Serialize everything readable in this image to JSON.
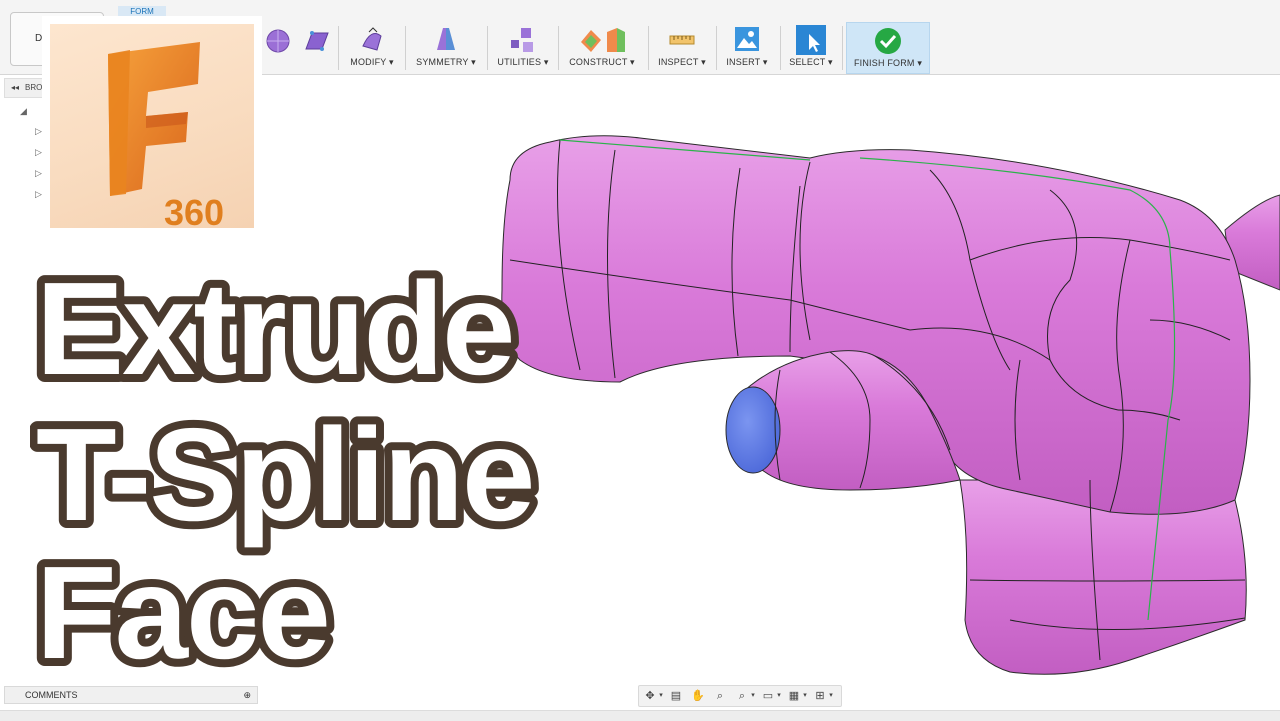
{
  "toolbar": {
    "form_tab": "FORM",
    "workspace_button": "D",
    "groups": [
      {
        "label": "MODIFY"
      },
      {
        "label": "SYMMETRY"
      },
      {
        "label": "UTILITIES"
      },
      {
        "label": "CONSTRUCT"
      },
      {
        "label": "INSPECT"
      },
      {
        "label": "INSERT"
      },
      {
        "label": "SELECT"
      },
      {
        "label": "FINISH FORM"
      }
    ]
  },
  "browser": {
    "label": "BRO"
  },
  "logo": {
    "text": "360"
  },
  "title": {
    "line1": "Extrude",
    "line2": "T-Spline",
    "line3": "Face"
  },
  "bottom": {
    "comments_label": "COMMENTS"
  },
  "colors": {
    "model_fill": "#d97ad9",
    "selected_face": "#5b7ae6",
    "title_outline": "#4a3a2e",
    "finish_form_bg": "#cfe6f7",
    "logo_orange": "#e07f1f"
  }
}
